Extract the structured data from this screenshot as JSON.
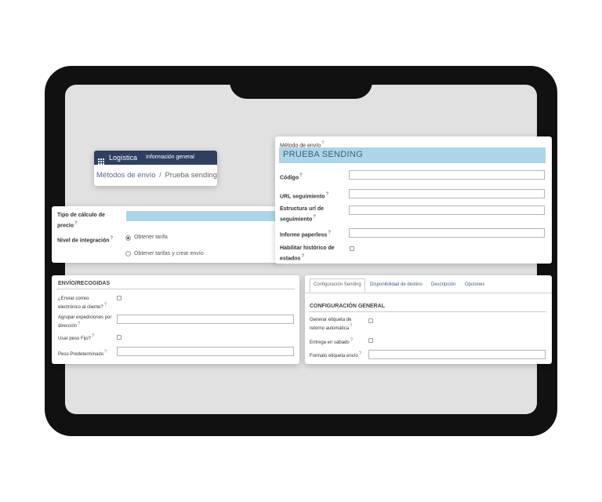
{
  "nav": {
    "app_name": "Logística",
    "menu_item": "Información general",
    "breadcrumb_parent": "Métodos de envío",
    "breadcrumb_sep": "/",
    "breadcrumb_current": "Prueba sending"
  },
  "price_card": {
    "price_type_label": "Tipo de cálculo de precio",
    "integration_label": "Nivel de integración",
    "option_1": "Obtener tarifa",
    "option_2": "Obtener tarifas y crear envío",
    "selected_option": "Obtener tarifa"
  },
  "method_card": {
    "method_label": "Método de envío",
    "method_value": "PRUEBA SENDING",
    "code_label": "Código",
    "tracking_url_label": "URL seguimiento",
    "tracking_struct_label": "Estructura url de seguimiento",
    "paperless_label": "Informe paperless",
    "history_label": "Habilitar histórico de estados"
  },
  "shipping_card": {
    "title": "ENVÍO/RECOGIDAS",
    "email_label": "¿Enviar correo electrónico al cliente?",
    "group_label": "Agrupar expediciones por dirección",
    "fixed_weight_label": "Usar peso Fijo?",
    "default_weight_label": "Peso Predeterminado"
  },
  "config_card": {
    "tabs": [
      "Configuración Sending",
      "Disponibilidad de destino",
      "Descripción",
      "Opciones"
    ],
    "active_tab": "Configuración Sending",
    "section_title": "CONFIGURACIÓN GENERAL",
    "return_label": "Generar etiqueta de retorno automática",
    "saturday_label": "Entrega en sábado",
    "label_format_label": "Formato etiqueta envío"
  },
  "colors": {
    "nav_bg": "#2f3f5f",
    "highlight_field": "#acd5ea",
    "tablet_frame": "#111111",
    "screen_bg": "#e1e1e1"
  }
}
